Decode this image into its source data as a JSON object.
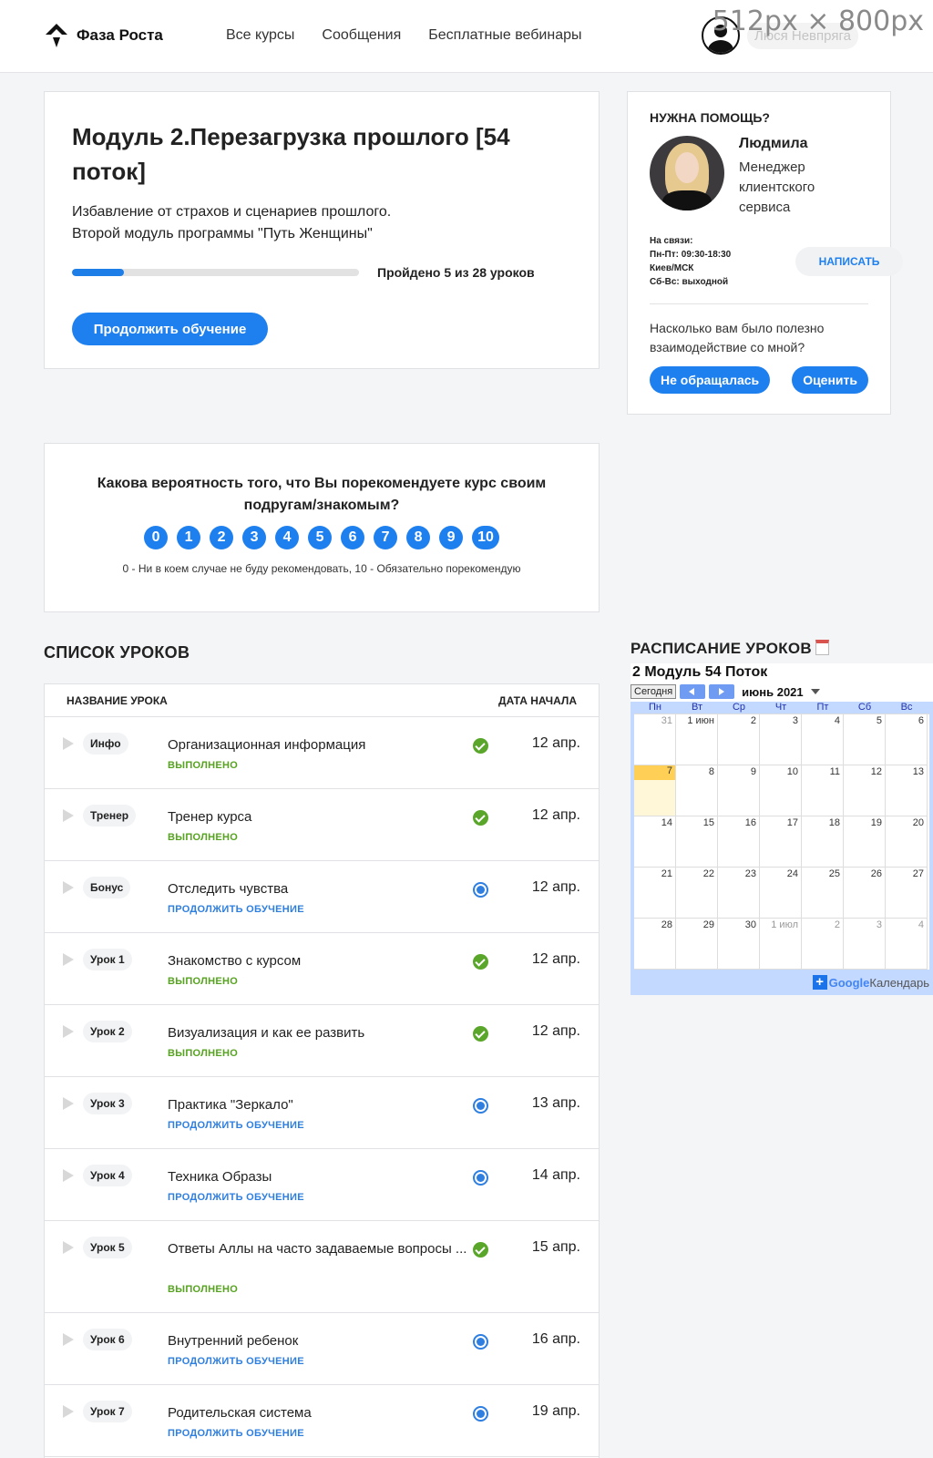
{
  "size_badge": "512px × 800px",
  "header": {
    "logo_text": "Фаза Роста",
    "nav": [
      "Все курсы",
      "Сообщения",
      "Бесплатные вебинары"
    ],
    "user_name": "Люся Невпряга"
  },
  "module": {
    "title": "Модуль 2.Перезагрузка прошлого [54 поток]",
    "desc_line1": "Избавление от страхов и сценариев прошлого.",
    "desc_line2": "Второй модуль программы \"Путь Женщины\"",
    "progress_fraction": 0.18,
    "progress_text": "Пройдено 5 из 28 уроков",
    "continue_label": "Продолжить обучение"
  },
  "help": {
    "title": "НУЖНА ПОМОЩЬ?",
    "manager_name": "Людмила",
    "manager_role": "Менеджер клиентского сервиса",
    "contact_lines": [
      "На связи:",
      "Пн-Пт: 09:30-18:30",
      "Киев/МСК",
      "Сб-Вс: выходной"
    ],
    "write_label": "НАПИСАТЬ",
    "rate_question": "Насколько вам было полезно взаимодействие со мной?",
    "not_contacted_label": "Не обращалась",
    "rate_label": "Оценить"
  },
  "nps": {
    "question": "Какова вероятность того, что Вы порекомендуете курс своим подругам/знакомым?",
    "scale": [
      "0",
      "1",
      "2",
      "3",
      "4",
      "5",
      "6",
      "7",
      "8",
      "9",
      "10"
    ],
    "legend": "0 - Ни в коем случае не буду рекомендовать, 10 - Обязательно порекомендую"
  },
  "lessons": {
    "section_title": "СПИСОК УРОКОВ",
    "col_name": "НАЗВАНИЕ УРОКА",
    "col_date": "ДАТА НАЧАЛА",
    "rows": [
      {
        "tag": "Инфо",
        "name": "Организационная информация",
        "status": "ВЫПОЛНЕНО",
        "state": "done",
        "date": "12 апр."
      },
      {
        "tag": "Тренер",
        "name": "Тренер курса",
        "status": "ВЫПОЛНЕНО",
        "state": "done",
        "date": "12 апр."
      },
      {
        "tag": "Бонус",
        "name": "Отследить чувства",
        "status": "ПРОДОЛЖИТЬ ОБУЧЕНИЕ",
        "state": "progress",
        "date": "12 апр."
      },
      {
        "tag": "Урок 1",
        "name": "Знакомство с курсом",
        "status": "ВЫПОЛНЕНО",
        "state": "done",
        "date": "12 апр."
      },
      {
        "tag": "Урок 2",
        "name": "Визуализация и как ее развить",
        "status": "ВЫПОЛНЕНО",
        "state": "done",
        "date": "12 апр."
      },
      {
        "tag": "Урок 3",
        "name": "Практика \"Зеркало\"",
        "status": "ПРОДОЛЖИТЬ ОБУЧЕНИЕ",
        "state": "progress",
        "date": "13 апр."
      },
      {
        "tag": "Урок 4",
        "name": "Техника Образы",
        "status": "ПРОДОЛЖИТЬ ОБУЧЕНИЕ",
        "state": "progress",
        "date": "14 апр."
      },
      {
        "tag": "Урок 5",
        "name": "Ответы Аллы на часто задаваемые вопросы ...",
        "status": "ВЫПОЛНЕНО",
        "state": "done",
        "date": "15 апр."
      },
      {
        "tag": "Урок 6",
        "name": "Внутренний ребенок",
        "status": "ПРОДОЛЖИТЬ ОБУЧЕНИЕ",
        "state": "progress",
        "date": "16 апр."
      },
      {
        "tag": "Урок 7",
        "name": "Родительская система",
        "status": "ПРОДОЛЖИТЬ ОБУЧЕНИЕ",
        "state": "progress",
        "date": "19 апр."
      }
    ]
  },
  "schedule": {
    "section_title": "РАСПИСАНИЕ УРОКОВ",
    "calendar_title": "2 Модуль 54 Поток",
    "today_label": "Сегодня",
    "month_label": "июнь 2021",
    "weekdays": [
      "Пн",
      "Вт",
      "Ср",
      "Чт",
      "Пт",
      "Сб",
      "Вс"
    ],
    "days": [
      {
        "label": "31",
        "other": true
      },
      {
        "label": "1 июн"
      },
      {
        "label": "2"
      },
      {
        "label": "3"
      },
      {
        "label": "4"
      },
      {
        "label": "5"
      },
      {
        "label": "6"
      },
      {
        "label": "7",
        "today": true
      },
      {
        "label": "8"
      },
      {
        "label": "9"
      },
      {
        "label": "10"
      },
      {
        "label": "11"
      },
      {
        "label": "12"
      },
      {
        "label": "13"
      },
      {
        "label": "14"
      },
      {
        "label": "15"
      },
      {
        "label": "16"
      },
      {
        "label": "17"
      },
      {
        "label": "18"
      },
      {
        "label": "19"
      },
      {
        "label": "20"
      },
      {
        "label": "21"
      },
      {
        "label": "22"
      },
      {
        "label": "23"
      },
      {
        "label": "24"
      },
      {
        "label": "25"
      },
      {
        "label": "26"
      },
      {
        "label": "27"
      },
      {
        "label": "28"
      },
      {
        "label": "29"
      },
      {
        "label": "30"
      },
      {
        "label": "1 июл",
        "other": true
      },
      {
        "label": "2",
        "other": true
      },
      {
        "label": "3",
        "other": true
      },
      {
        "label": "4",
        "other": true
      }
    ],
    "footer_brand": "Google",
    "footer_text": "Календарь"
  },
  "colors": {
    "accent": "#1e80ef",
    "done": "#56a31f",
    "continue": "#2e7fe0"
  }
}
